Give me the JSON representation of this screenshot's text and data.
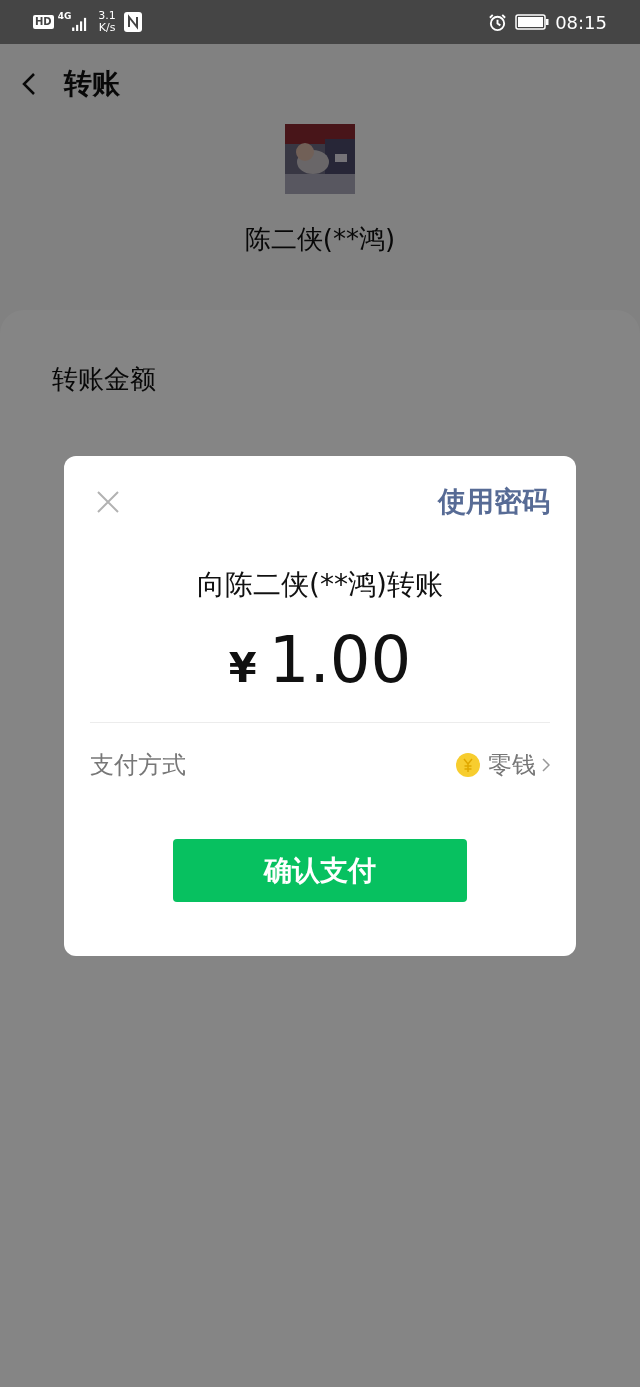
{
  "status_bar": {
    "hd": "HD",
    "network": "4G",
    "speed_value": "3.1",
    "speed_unit": "K/s",
    "time": "08:15"
  },
  "header": {
    "title": "转账"
  },
  "payee": {
    "name": "陈二侠(**鸿)"
  },
  "transfer": {
    "label": "转账金额"
  },
  "dialog": {
    "use_password": "使用密码",
    "title": "向陈二侠(**鸿)转账",
    "currency": "¥",
    "amount": "1.00",
    "method_label": "支付方式",
    "method_value": "零钱",
    "confirm": "确认支付"
  }
}
